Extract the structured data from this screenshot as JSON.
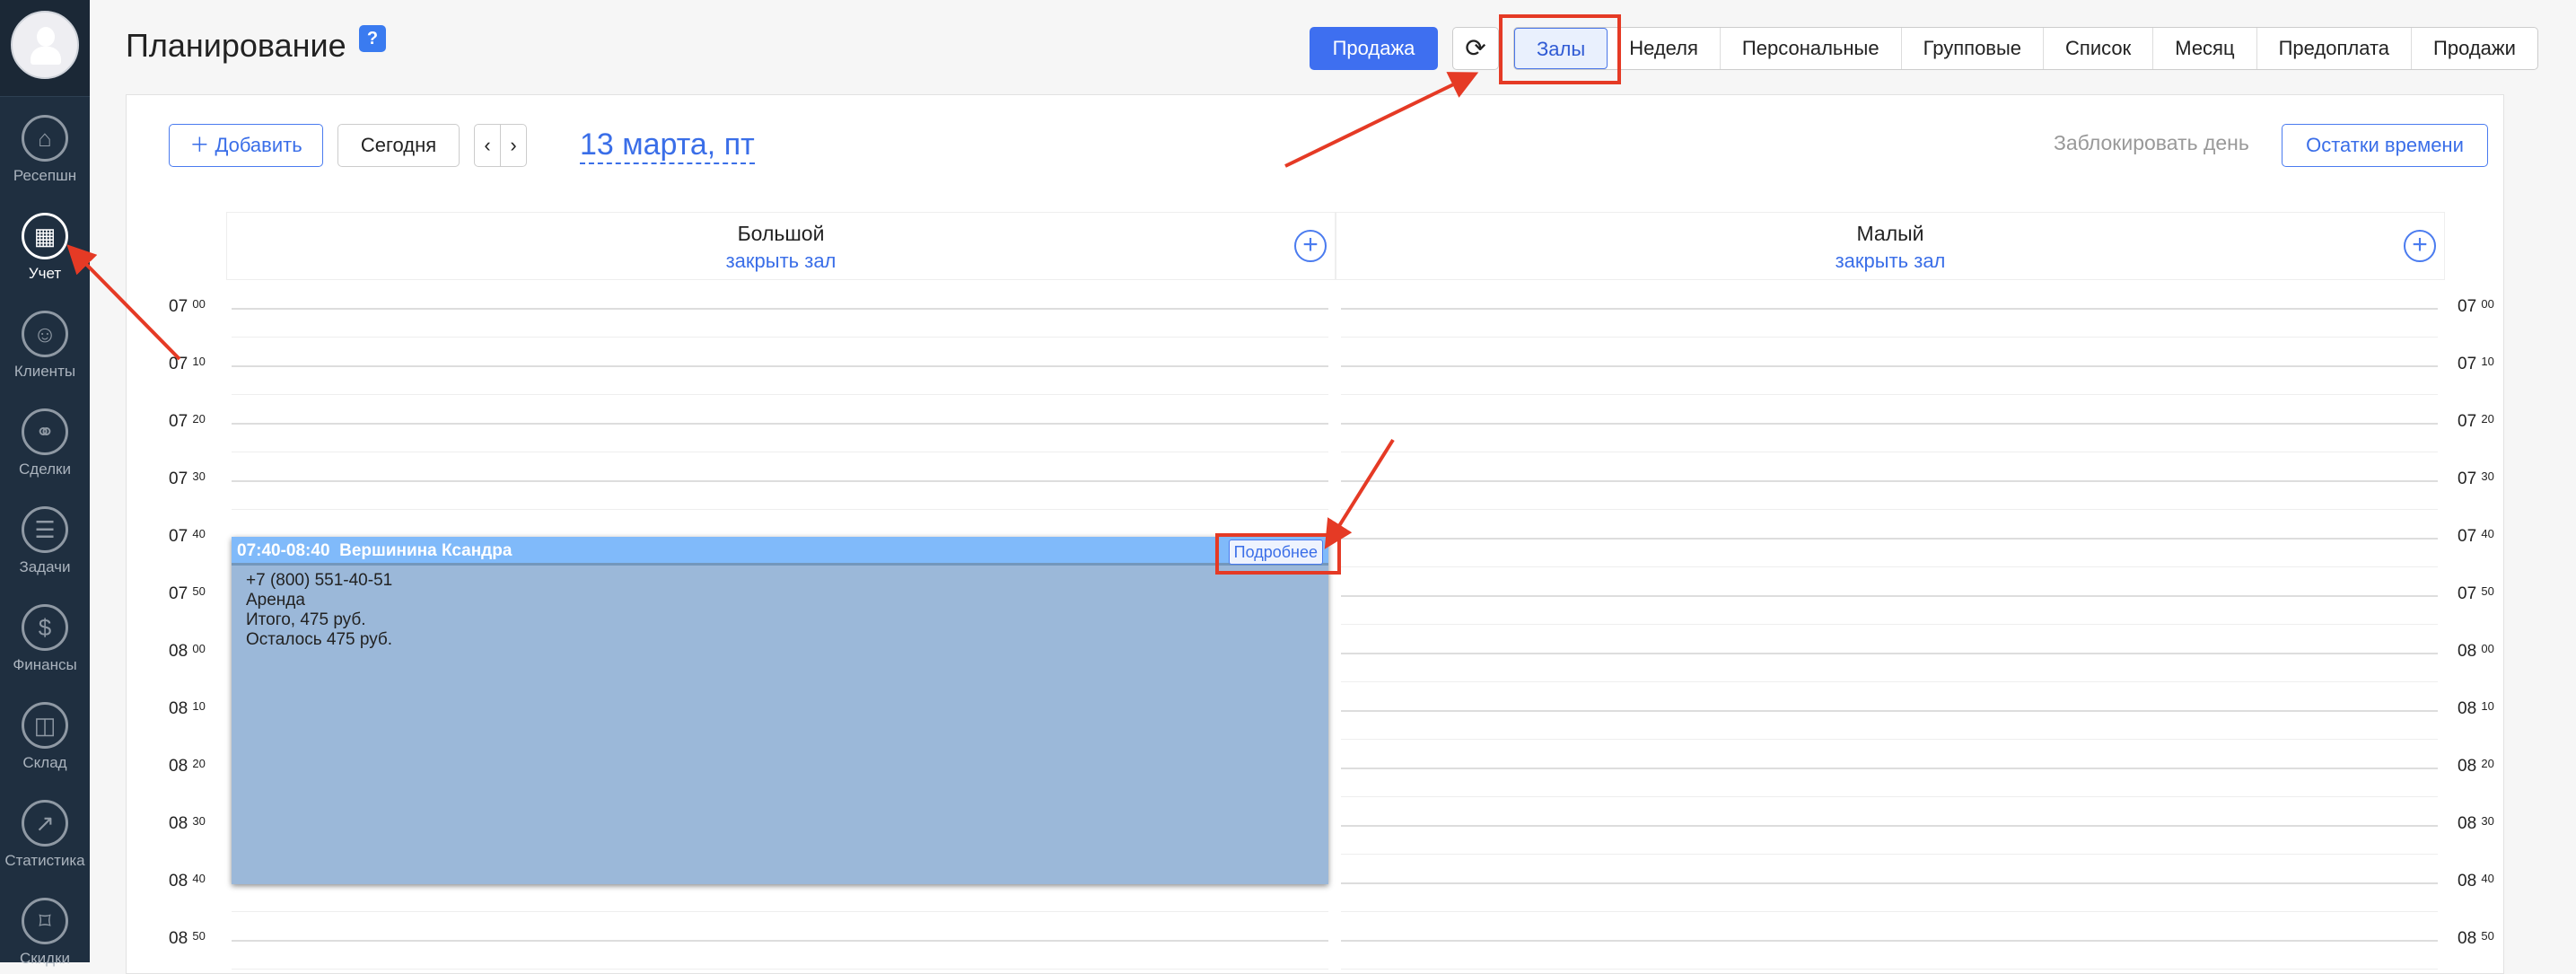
{
  "sidebar": {
    "items": [
      {
        "label": "Ресепшн",
        "icon": "home-icon"
      },
      {
        "label": "Учет",
        "icon": "calendar-icon",
        "active": true
      },
      {
        "label": "Клиенты",
        "icon": "user-icon"
      },
      {
        "label": "Сделки",
        "icon": "handshake-icon"
      },
      {
        "label": "Задачи",
        "icon": "tasks-icon"
      },
      {
        "label": "Финансы",
        "icon": "dollar-icon"
      },
      {
        "label": "Склад",
        "icon": "box-icon"
      },
      {
        "label": "Статистика",
        "icon": "chart-icon"
      },
      {
        "label": "Скидки",
        "icon": "tag-icon"
      }
    ]
  },
  "header": {
    "title": "Планирование",
    "help": "?",
    "sale": "Продажа",
    "tabs": [
      "Залы",
      "Неделя",
      "Персональные",
      "Групповые",
      "Список",
      "Месяц",
      "Предоплата",
      "Продажи"
    ],
    "active_tab": "Залы"
  },
  "toolbar": {
    "add": "Добавить",
    "today": "Сегодня",
    "date": "13 марта, пт",
    "block_day": "Заблокировать день",
    "time_left": "Остатки времени"
  },
  "halls": [
    {
      "name": "Большой",
      "close": "закрыть зал"
    },
    {
      "name": "Малый",
      "close": "закрыть зал"
    }
  ],
  "times": [
    [
      "07",
      "00"
    ],
    [
      "07",
      "10"
    ],
    [
      "07",
      "20"
    ],
    [
      "07",
      "30"
    ],
    [
      "07",
      "40"
    ],
    [
      "07",
      "50"
    ],
    [
      "08",
      "00"
    ],
    [
      "08",
      "10"
    ],
    [
      "08",
      "20"
    ],
    [
      "08",
      "30"
    ],
    [
      "08",
      "40"
    ],
    [
      "08",
      "50"
    ]
  ],
  "event": {
    "time": "07:40-08:40",
    "name": "Вершинина Ксандра",
    "phone": "+7 (800) 551-40-51",
    "type": "Аренда",
    "total": "Итого, 475 руб.",
    "left": "Осталось 475 руб.",
    "more": "Подробнее"
  }
}
